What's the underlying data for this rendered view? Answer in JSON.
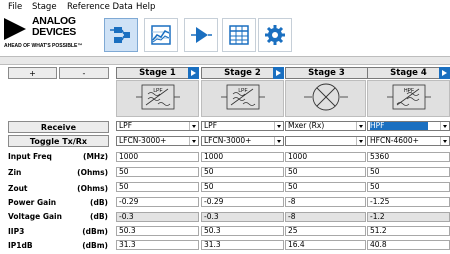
{
  "menu": [
    "File",
    "Stage",
    "Reference Data",
    "Help"
  ],
  "logo": {
    "line1": "ANALOG",
    "line2": "DEVICES",
    "tagline": "AHEAD OF WHAT'S POSSIBLE™"
  },
  "toolbar": {
    "buttons": [
      {
        "icon": "block-diagram-icon",
        "selected": true
      },
      {
        "icon": "graph-icon",
        "selected": false
      },
      {
        "icon": "amplifier-icon",
        "selected": false
      },
      {
        "icon": "table-icon",
        "selected": false
      },
      {
        "icon": "gear-icon",
        "selected": false
      }
    ]
  },
  "left_panel": {
    "plus_label": "+",
    "minus_label": "-",
    "receive_label": "Receive",
    "toggle_label": "Toggle Tx/Rx",
    "params": [
      {
        "name": "Input Freq",
        "unit": "(MHz)"
      },
      {
        "name": "Zin",
        "unit": "(Ohms)"
      },
      {
        "name": "Zout",
        "unit": "(Ohms)"
      },
      {
        "name": "Power Gain",
        "unit": "(dB)"
      },
      {
        "name": "Voltage Gain",
        "unit": "(dB)"
      },
      {
        "name": "IIP3",
        "unit": "(dBm)"
      },
      {
        "name": "IP1dB",
        "unit": "(dBm)"
      }
    ]
  },
  "stages": [
    {
      "name": "Stage 1",
      "diagram_label": "LPF",
      "type": "LPF",
      "part": "LFCN-3000+",
      "values": [
        "1000",
        "50",
        "50",
        "-0.29",
        "-0.3",
        "50.3",
        "31.3"
      ]
    },
    {
      "name": "Stage 2",
      "diagram_label": "LPF",
      "type": "LPF",
      "part": "LFCN-3000+",
      "values": [
        "1000",
        "50",
        "50",
        "-0.29",
        "-0.3",
        "50.3",
        "31.3"
      ]
    },
    {
      "name": "Stage 3",
      "diagram_label": "",
      "type": "Mxer (Rx)",
      "part": "",
      "values": [
        "1000",
        "50",
        "50",
        "-8",
        "-8",
        "25",
        "16.4"
      ]
    },
    {
      "name": "Stage 4",
      "diagram_label": "HPF",
      "type": "HPF",
      "part": "HFCN-4600+",
      "values": [
        "5360",
        "50",
        "50",
        "-1.25",
        "-1.2",
        "51.2",
        "40.8"
      ]
    }
  ],
  "colors": {
    "accent": "#1a6fc0",
    "readonly": "#e3e3e3",
    "panel": "#e8e8e8"
  }
}
